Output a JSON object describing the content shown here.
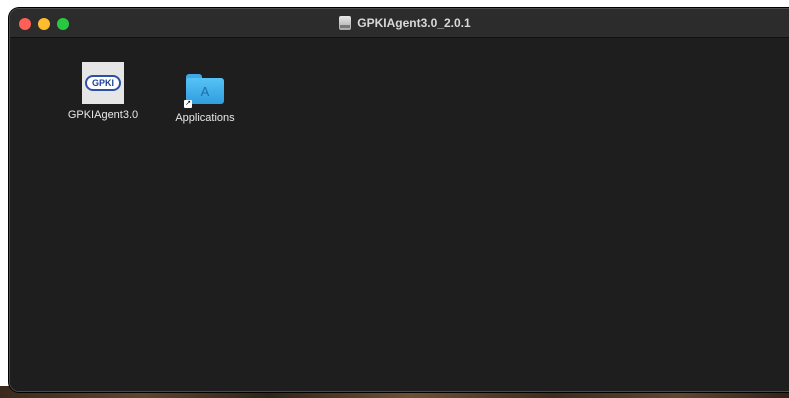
{
  "window": {
    "title": "GPKIAgent3.0_2.0.1"
  },
  "items": [
    {
      "label": "GPKIAgent3.0",
      "icon_text": "GPKI"
    },
    {
      "label": "Applications",
      "icon_glyph": "A"
    }
  ],
  "icons": {
    "title_icon": "disk-image-icon",
    "app_icon": "gpki-agent-app-icon",
    "folder_icon": "applications-folder-icon",
    "alias_badge": "alias-arrow-icon"
  },
  "colors": {
    "window_background": "#1e1e1e",
    "titlebar": "#2d2c2d",
    "close": "#ff5f57",
    "minimize": "#febc2e",
    "zoom": "#28c840",
    "folder": "#3fa9e6"
  }
}
